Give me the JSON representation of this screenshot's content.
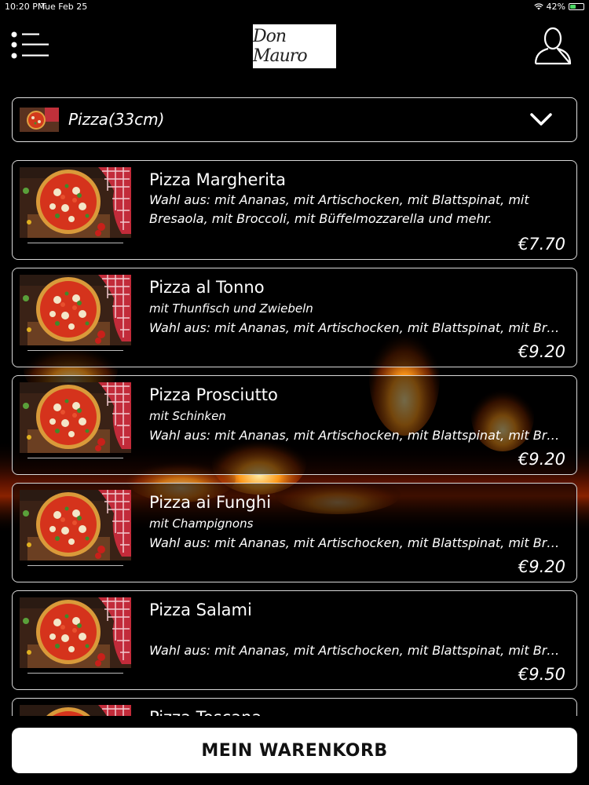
{
  "status_bar": {
    "time": "10:20 PM",
    "date": "Tue Feb 25",
    "battery": "42%",
    "battery_level": 0.42
  },
  "header": {
    "logo_text": "Don Mauro"
  },
  "category": {
    "label": "Pizza(33cm)"
  },
  "items": [
    {
      "title": "Pizza Margherita",
      "subtitle": "",
      "description": "Wahl aus: mit Ananas, mit Artischocken, mit Blattspinat, mit Bresaola, mit Broccoli, mit Büffelmozzarella und mehr.",
      "price": "€7.70"
    },
    {
      "title": "Pizza al Tonno",
      "subtitle": "mit Thunfisch und Zwiebeln",
      "description": "Wahl aus: mit Ananas, mit Artischocken, mit Blattspinat, mit Bresa...",
      "price": "€9.20"
    },
    {
      "title": " Pizza Prosciutto",
      "subtitle": "mit Schinken",
      "description": "Wahl aus: mit Ananas, mit Artischocken, mit Blattspinat, mit Bresa...",
      "price": "€9.20"
    },
    {
      "title": "Pizza ai Funghi",
      "subtitle": "mit Champignons",
      "description": "Wahl aus: mit Ananas, mit Artischocken, mit Blattspinat, mit Bresa...",
      "price": "€9.20"
    },
    {
      "title": "Pizza Salami",
      "subtitle": "",
      "description": "Wahl aus: mit Ananas, mit Artischocken, mit Blattspinat, mit Bresa...",
      "price": "€9.50"
    },
    {
      "title": "Pizza Toscana",
      "subtitle": "",
      "description": "",
      "price": ""
    }
  ],
  "cart": {
    "label": "MEIN WARENKORB"
  },
  "colors": {
    "background": "#000000",
    "card_border": "#d8d8d8",
    "button_bg": "#ffffff",
    "button_text": "#111111",
    "battery_fill": "#4cd964"
  }
}
